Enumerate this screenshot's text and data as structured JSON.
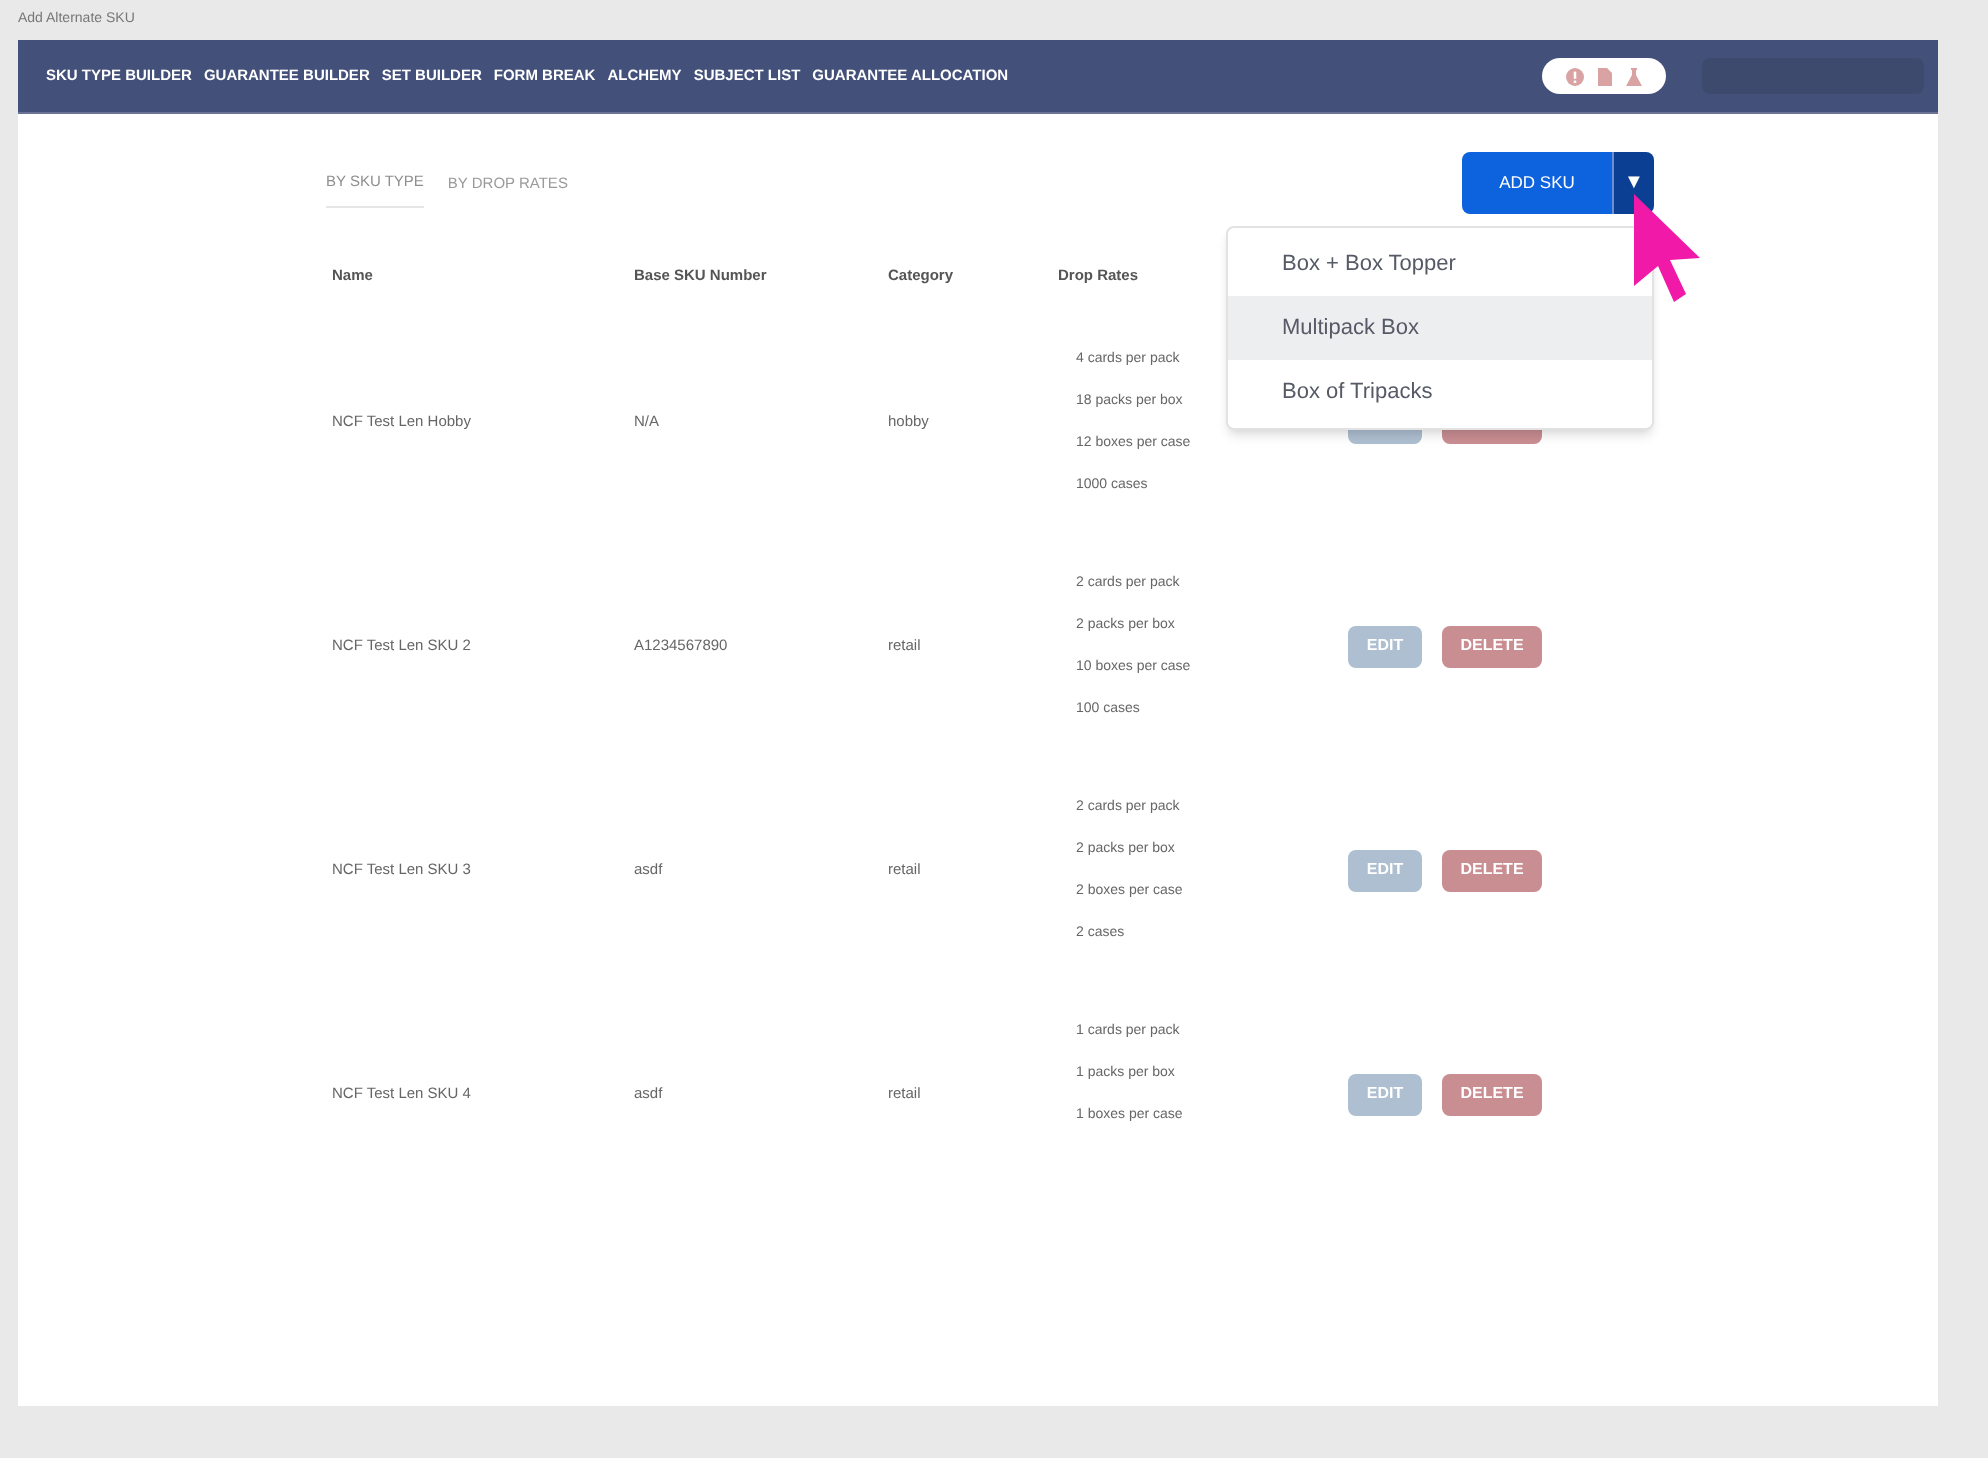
{
  "page_title": "Add Alternate SKU",
  "nav": {
    "items": [
      "SKU TYPE BUILDER",
      "GUARANTEE BUILDER",
      "SET BUILDER",
      "FORM BREAK",
      "ALCHEMY",
      "SUBJECT LIST",
      "GUARANTEE ALLOCATION"
    ]
  },
  "tabs": [
    {
      "label": "BY SKU TYPE",
      "selected": true
    },
    {
      "label": "BY DROP RATES",
      "selected": false
    }
  ],
  "add_button": {
    "label": "ADD SKU",
    "caret": "▼"
  },
  "menu": {
    "items": [
      {
        "label": "Box + Box Topper",
        "highlighted": false
      },
      {
        "label": "Multipack Box",
        "highlighted": true
      },
      {
        "label": "Box of Tripacks",
        "highlighted": false
      }
    ]
  },
  "table": {
    "columns": [
      "Name",
      "Base SKU Number",
      "Category",
      "Drop Rates"
    ],
    "rows": [
      {
        "name": "NCF Test Len Hobby",
        "base_sku": "N/A",
        "category": "hobby",
        "drop_rates": [
          "4 cards per pack",
          "18 packs per box",
          "12 boxes per case",
          "1000 cases"
        ],
        "actions": [
          {
            "kind": "edit"
          },
          {
            "kind": "delete"
          }
        ]
      },
      {
        "name": "NCF Test Len SKU 2",
        "base_sku": "A1234567890",
        "category": "retail",
        "drop_rates": [
          "2 cards per pack",
          "2 packs per box",
          "10 boxes per case",
          "100 cases"
        ],
        "actions": [
          {
            "kind": "edit",
            "label": "EDIT"
          },
          {
            "kind": "delete",
            "label": "DELETE"
          }
        ]
      },
      {
        "name": "NCF Test Len SKU 3",
        "base_sku": "asdf",
        "category": "retail",
        "drop_rates": [
          "2 cards per pack",
          "2 packs per box",
          "2 boxes per case",
          "2 cases"
        ],
        "actions": [
          {
            "kind": "edit",
            "label": "EDIT"
          },
          {
            "kind": "delete",
            "label": "DELETE"
          }
        ]
      },
      {
        "name": "NCF Test Len SKU 4",
        "base_sku": "asdf",
        "category": "retail",
        "drop_rates": [
          "1 cards per pack",
          "1 packs per box",
          "1 boxes per case"
        ],
        "actions": [
          {
            "kind": "edit",
            "label": "EDIT"
          },
          {
            "kind": "delete",
            "label": "DELETE"
          }
        ]
      }
    ]
  }
}
